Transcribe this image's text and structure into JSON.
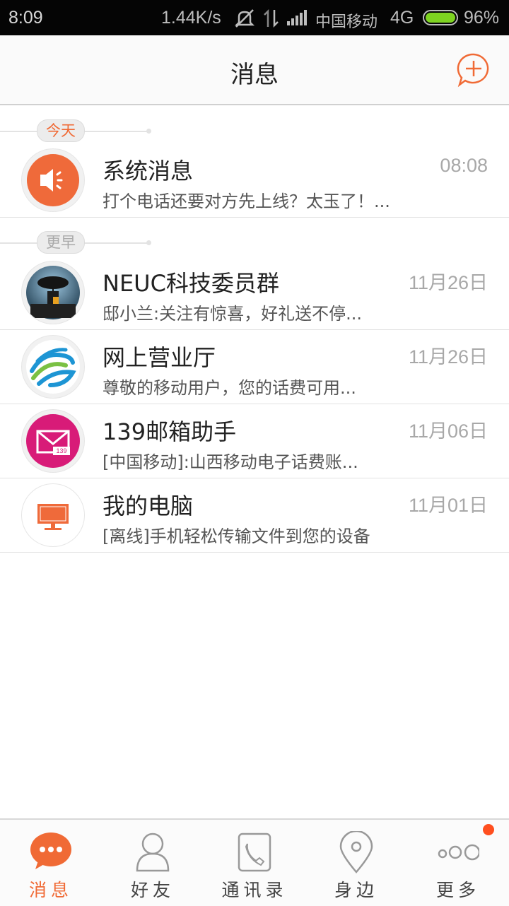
{
  "status_bar": {
    "time": "8:09",
    "speed": "1.44K/s",
    "carrier": "中国移动",
    "network": "4G",
    "battery": "96%",
    "battery_level": 0.96
  },
  "header": {
    "title": "消息",
    "add_icon": "add-chat-icon"
  },
  "sections": {
    "today": "今天",
    "earlier": "更早"
  },
  "messages": [
    {
      "name": "系统消息",
      "time": "08:08",
      "preview": "打个电话还要对方先上线？太玉了！...",
      "icon": "speaker-icon"
    },
    {
      "name": "NEUC科技委员群",
      "time": "11月26日",
      "preview": "邸小兰:关注有惊喜，好礼送不停...",
      "icon": "group-photo-avatar"
    },
    {
      "name": "网上营业厅",
      "time": "11月26日",
      "preview": "尊敬的移动用户，您的话费可用...",
      "icon": "china-mobile-logo"
    },
    {
      "name": "139邮箱助手",
      "time": "11月06日",
      "preview": "[中国移动]:山西移动电子话费账...",
      "icon": "mail-139-icon"
    },
    {
      "name": "我的电脑",
      "time": "11月01日",
      "preview": "[离线]手机轻松传输文件到您的设备",
      "icon": "monitor-icon"
    }
  ],
  "tabs": [
    {
      "label": "消息",
      "icon": "chat-bubble-icon",
      "active": true
    },
    {
      "label": "好友",
      "icon": "person-icon",
      "active": false
    },
    {
      "label": "通讯录",
      "icon": "phone-book-icon",
      "active": false
    },
    {
      "label": "身边",
      "icon": "location-pin-icon",
      "active": false
    },
    {
      "label": "更多",
      "icon": "more-circles-icon",
      "active": false
    }
  ],
  "colors": {
    "accent": "#f06a35",
    "status_bg": "#050505",
    "badge": "#ff4f1f"
  }
}
